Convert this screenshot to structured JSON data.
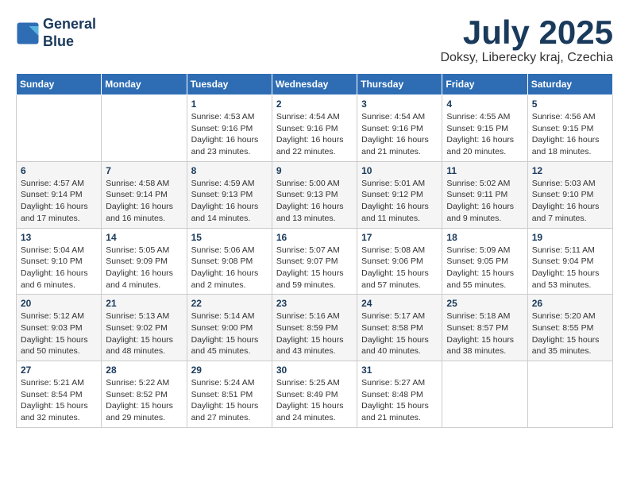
{
  "header": {
    "logo_line1": "General",
    "logo_line2": "Blue",
    "month": "July 2025",
    "location": "Doksy, Liberecky kraj, Czechia"
  },
  "days_of_week": [
    "Sunday",
    "Monday",
    "Tuesday",
    "Wednesday",
    "Thursday",
    "Friday",
    "Saturday"
  ],
  "weeks": [
    [
      {
        "day": "",
        "info": ""
      },
      {
        "day": "",
        "info": ""
      },
      {
        "day": "1",
        "info": "Sunrise: 4:53 AM\nSunset: 9:16 PM\nDaylight: 16 hours\nand 23 minutes."
      },
      {
        "day": "2",
        "info": "Sunrise: 4:54 AM\nSunset: 9:16 PM\nDaylight: 16 hours\nand 22 minutes."
      },
      {
        "day": "3",
        "info": "Sunrise: 4:54 AM\nSunset: 9:16 PM\nDaylight: 16 hours\nand 21 minutes."
      },
      {
        "day": "4",
        "info": "Sunrise: 4:55 AM\nSunset: 9:15 PM\nDaylight: 16 hours\nand 20 minutes."
      },
      {
        "day": "5",
        "info": "Sunrise: 4:56 AM\nSunset: 9:15 PM\nDaylight: 16 hours\nand 18 minutes."
      }
    ],
    [
      {
        "day": "6",
        "info": "Sunrise: 4:57 AM\nSunset: 9:14 PM\nDaylight: 16 hours\nand 17 minutes."
      },
      {
        "day": "7",
        "info": "Sunrise: 4:58 AM\nSunset: 9:14 PM\nDaylight: 16 hours\nand 16 minutes."
      },
      {
        "day": "8",
        "info": "Sunrise: 4:59 AM\nSunset: 9:13 PM\nDaylight: 16 hours\nand 14 minutes."
      },
      {
        "day": "9",
        "info": "Sunrise: 5:00 AM\nSunset: 9:13 PM\nDaylight: 16 hours\nand 13 minutes."
      },
      {
        "day": "10",
        "info": "Sunrise: 5:01 AM\nSunset: 9:12 PM\nDaylight: 16 hours\nand 11 minutes."
      },
      {
        "day": "11",
        "info": "Sunrise: 5:02 AM\nSunset: 9:11 PM\nDaylight: 16 hours\nand 9 minutes."
      },
      {
        "day": "12",
        "info": "Sunrise: 5:03 AM\nSunset: 9:10 PM\nDaylight: 16 hours\nand 7 minutes."
      }
    ],
    [
      {
        "day": "13",
        "info": "Sunrise: 5:04 AM\nSunset: 9:10 PM\nDaylight: 16 hours\nand 6 minutes."
      },
      {
        "day": "14",
        "info": "Sunrise: 5:05 AM\nSunset: 9:09 PM\nDaylight: 16 hours\nand 4 minutes."
      },
      {
        "day": "15",
        "info": "Sunrise: 5:06 AM\nSunset: 9:08 PM\nDaylight: 16 hours\nand 2 minutes."
      },
      {
        "day": "16",
        "info": "Sunrise: 5:07 AM\nSunset: 9:07 PM\nDaylight: 15 hours\nand 59 minutes."
      },
      {
        "day": "17",
        "info": "Sunrise: 5:08 AM\nSunset: 9:06 PM\nDaylight: 15 hours\nand 57 minutes."
      },
      {
        "day": "18",
        "info": "Sunrise: 5:09 AM\nSunset: 9:05 PM\nDaylight: 15 hours\nand 55 minutes."
      },
      {
        "day": "19",
        "info": "Sunrise: 5:11 AM\nSunset: 9:04 PM\nDaylight: 15 hours\nand 53 minutes."
      }
    ],
    [
      {
        "day": "20",
        "info": "Sunrise: 5:12 AM\nSunset: 9:03 PM\nDaylight: 15 hours\nand 50 minutes."
      },
      {
        "day": "21",
        "info": "Sunrise: 5:13 AM\nSunset: 9:02 PM\nDaylight: 15 hours\nand 48 minutes."
      },
      {
        "day": "22",
        "info": "Sunrise: 5:14 AM\nSunset: 9:00 PM\nDaylight: 15 hours\nand 45 minutes."
      },
      {
        "day": "23",
        "info": "Sunrise: 5:16 AM\nSunset: 8:59 PM\nDaylight: 15 hours\nand 43 minutes."
      },
      {
        "day": "24",
        "info": "Sunrise: 5:17 AM\nSunset: 8:58 PM\nDaylight: 15 hours\nand 40 minutes."
      },
      {
        "day": "25",
        "info": "Sunrise: 5:18 AM\nSunset: 8:57 PM\nDaylight: 15 hours\nand 38 minutes."
      },
      {
        "day": "26",
        "info": "Sunrise: 5:20 AM\nSunset: 8:55 PM\nDaylight: 15 hours\nand 35 minutes."
      }
    ],
    [
      {
        "day": "27",
        "info": "Sunrise: 5:21 AM\nSunset: 8:54 PM\nDaylight: 15 hours\nand 32 minutes."
      },
      {
        "day": "28",
        "info": "Sunrise: 5:22 AM\nSunset: 8:52 PM\nDaylight: 15 hours\nand 29 minutes."
      },
      {
        "day": "29",
        "info": "Sunrise: 5:24 AM\nSunset: 8:51 PM\nDaylight: 15 hours\nand 27 minutes."
      },
      {
        "day": "30",
        "info": "Sunrise: 5:25 AM\nSunset: 8:49 PM\nDaylight: 15 hours\nand 24 minutes."
      },
      {
        "day": "31",
        "info": "Sunrise: 5:27 AM\nSunset: 8:48 PM\nDaylight: 15 hours\nand 21 minutes."
      },
      {
        "day": "",
        "info": ""
      },
      {
        "day": "",
        "info": ""
      }
    ]
  ]
}
